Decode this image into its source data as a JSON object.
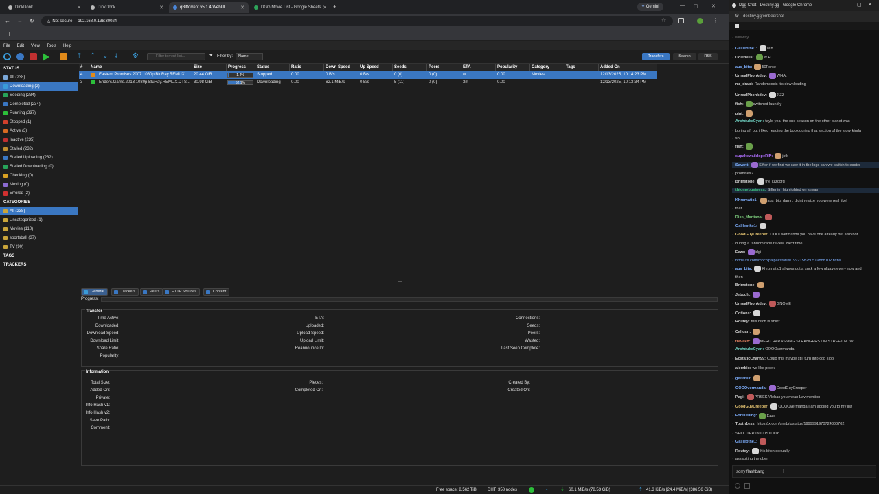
{
  "browser": {
    "tabs": [
      {
        "label": "DinkDonk"
      },
      {
        "label": "DinkDonk"
      },
      {
        "label": "qBittorrent v5.1.4 WebUI"
      },
      {
        "label": "DGG Movie List - Google Sheets"
      }
    ],
    "gemini_label": "Gemini",
    "not_secure": "Not secure",
    "url": "192.168.0.138:30024"
  },
  "qbt": {
    "menu": [
      "File",
      "Edit",
      "View",
      "Tools",
      "Help"
    ],
    "search_placeholder": "Filter torrent list...",
    "filter_by_label": "Filter by:",
    "filter_by_value": "Name",
    "right_buttons": {
      "transfers": "Transfers",
      "search": "Search",
      "rss": "RSS"
    },
    "sidebar": {
      "status_header": "STATUS",
      "status": [
        {
          "label": "All (238)",
          "color": "#7aa7d8"
        },
        {
          "label": "Downloading (2)",
          "color": "#3a9bd8",
          "selected": true
        },
        {
          "label": "Seeding (234)",
          "color": "#27a35a"
        },
        {
          "label": "Completed (234)",
          "color": "#3a77c2"
        },
        {
          "label": "Running (237)",
          "color": "#2cbf3a"
        },
        {
          "label": "Stopped (1)",
          "color": "#d0402c"
        },
        {
          "label": "Active (3)",
          "color": "#d86a22"
        },
        {
          "label": "Inactive (235)",
          "color": "#c03030"
        },
        {
          "label": "Stalled (232)",
          "color": "#c09030"
        },
        {
          "label": "Stalled Uploading (232)",
          "color": "#3a77c2"
        },
        {
          "label": "Stalled Downloading (0)",
          "color": "#27a35a"
        },
        {
          "label": "Checking (0)",
          "color": "#d8a022"
        },
        {
          "label": "Moving (0)",
          "color": "#8a6ad0"
        },
        {
          "label": "Errored (2)",
          "color": "#d03030"
        }
      ],
      "categories_header": "CATEGORIES",
      "categories": [
        {
          "label": "All (238)",
          "selected": true
        },
        {
          "label": "Uncategorized (1)"
        },
        {
          "label": "Movies (110)"
        },
        {
          "label": "sportsball (37)"
        },
        {
          "label": "TV (90)"
        }
      ],
      "tags_header": "TAGS",
      "trackers_header": "TRACKERS"
    },
    "columns": [
      "#",
      "Name",
      "Size",
      "Progress",
      "Status",
      "Ratio",
      "Down Speed",
      "Up Speed",
      "Seeds",
      "Peers",
      "ETA",
      "Popularity",
      "Category",
      "Tags",
      "Added On"
    ],
    "torrents": [
      {
        "num": "4",
        "name": "Eastern.Promises.2007.1080p.BluRay.REMUX...",
        "size": "20.44 GiB",
        "progress": 0.014,
        "progress_label": "1.4%",
        "status": "Stopped",
        "ratio": "0.00",
        "down": "0 B/s",
        "up": "0 B/s",
        "seeds": "0 (0)",
        "peers": "0 (0)",
        "eta": "∞",
        "popularity": "0.00",
        "category": "Movies",
        "tags": "",
        "added": "12/13/2025, 10:14:23 PM",
        "selected": true
      },
      {
        "num": "3",
        "name": "Enders.Game.2013.1080p.BluRay.REMUX.DTS...",
        "size": "30.98 GiB",
        "progress": 0.521,
        "progress_label": "52.1%",
        "status": "Downloading",
        "ratio": "0.00",
        "down": "62.1 MiB/s",
        "up": "0 B/s",
        "seeds": "5 (11)",
        "peers": "0 (0)",
        "eta": "3m",
        "popularity": "0.00",
        "category": "",
        "tags": "",
        "added": "12/13/2025, 10:13:34 PM",
        "selected": false
      }
    ],
    "prop_tabs": [
      "General",
      "Trackers",
      "Peers",
      "HTTP Sources",
      "Content"
    ],
    "progress_label": "Progress:",
    "transfer_header": "Transfer",
    "transfer_col1": [
      "Time Active:",
      "Downloaded:",
      "Download Speed:",
      "Download Limit:",
      "Share Ratio:",
      "Popularity:"
    ],
    "transfer_col2": [
      "ETA:",
      "Uploaded:",
      "Upload Speed:",
      "Upload Limit:",
      "Reannounce In:"
    ],
    "transfer_col3": [
      "Connections:",
      "Seeds:",
      "Peers:",
      "Wasted:",
      "Last Seen Complete:"
    ],
    "info_header": "Information",
    "info_col1": [
      "Total Size:",
      "Added On:",
      "Private:",
      "Info Hash v1:",
      "Info Hash v2:",
      "Save Path:",
      "Comment:"
    ],
    "info_col2": [
      "Pieces:",
      "Completed On:"
    ],
    "info_col3": [
      "Created By:",
      "Created On:"
    ],
    "statusbar": {
      "free_space": "Free space: 8.562 TiB",
      "dht": "DHT: 358 nodes",
      "down": "60.1 MiB/s (78.53 GiB)",
      "up": "41.3 KiB/s [24.4 MiB/s] (386.56 GiB)"
    }
  },
  "chat": {
    "window_title": "Dgg Chat - Destiny.gg - Google Chrome",
    "url": "destiny.gg/embed/chat",
    "messages": [
      {
        "user": "",
        "text": "wiwway",
        "color": "#777"
      },
      {
        "user": "Galileothe1:",
        "text": "w h",
        "color": "#7fb0ff"
      },
      {
        "user": "Dolemilis:",
        "text": "W H",
        "color": "#ccc"
      },
      {
        "user": "aus_bits:",
        "text": "50Force",
        "color": "#7fb0ff"
      },
      {
        "user": "UnrealPhonkdev:",
        "text": "WHAt",
        "color": "#ccc"
      },
      {
        "user": "mr_drapi:",
        "text": "Randomcosis it's downloading",
        "color": "#ccc"
      },
      {
        "user": "UnrealPhonkdev:",
        "text": "JIZZ",
        "color": "#ccc"
      },
      {
        "user": "fish:",
        "text": "switched laundry",
        "color": "#ccc"
      },
      {
        "user": "pipi:",
        "text": "",
        "color": "#ccc"
      },
      {
        "user": "ArchdukeCyan:",
        "text": "taylo yea, the one season on the other planet was",
        "color": "#6fd0c0"
      },
      {
        "user": "",
        "text": "boring af, but i liked reading the book during that section of the story kinda",
        "color": "#ccc"
      },
      {
        "user": "",
        "text": "so",
        "color": "#ccc"
      },
      {
        "user": "fish:",
        "text": "",
        "color": "#ccc"
      },
      {
        "user": "supakewaildopeRIP:",
        "text": "jstk",
        "color": "#b070ff"
      },
      {
        "user": "Savant:",
        "text": "Siffer if we find we saw it in the logs can we switch to easter",
        "color": "#7fb0ff"
      },
      {
        "user": "",
        "text": "promises?",
        "color": "#ccc"
      },
      {
        "user": "Brimstone:",
        "text": "the jizzcord",
        "color": "#ccc"
      },
      {
        "user": "thtomybusiness:",
        "text": "Siffer im highlighted on stream",
        "color": "#3fc07f"
      },
      {
        "user": "Khromatic1:",
        "text": "aus_bits damn, didnt realize you were real likeI",
        "color": "#7fb0ff"
      },
      {
        "user": "",
        "text": "that",
        "color": "#ccc"
      },
      {
        "user": "Rick_Montana:",
        "text": "",
        "color": "#7fd07f"
      },
      {
        "user": "Galileothe1:",
        "text": "",
        "color": "#7fb0ff"
      },
      {
        "user": "GoodGuyCreeper:",
        "text": "OOOOvermanda you have one already but also not",
        "color": "#e0c070"
      },
      {
        "user": "",
        "text": "during a random rape review. Next time",
        "color": "#ccc"
      },
      {
        "user": "Eaze:",
        "text": "idgi",
        "color": "#ccc"
      },
      {
        "user": "",
        "text": "https://x.com/mochipaipai/status/1992158250519888102 nsfw",
        "color": "#7fb0ff"
      },
      {
        "user": "aus_bits:",
        "text": "Khromatic1 always gotta suck a few glizzys every now and",
        "color": "#7fb0ff"
      },
      {
        "user": "",
        "text": "then",
        "color": "#ccc"
      },
      {
        "user": "Brimstone:",
        "text": "",
        "color": "#ccc"
      },
      {
        "user": "Jebouh:",
        "text": "",
        "color": "#ccc"
      },
      {
        "user": "UnrealPhonkdev:",
        "text": "GNOME",
        "color": "#ccc"
      },
      {
        "user": "Cotions:",
        "text": "",
        "color": "#ccc"
      },
      {
        "user": "Routey:",
        "text": "this bitch is shiltz",
        "color": "#ccc"
      },
      {
        "user": "Caligari:",
        "text": "",
        "color": "#ccc"
      },
      {
        "user": "travakh:",
        "text": "MERC HARASSING STRANGERS ON STREET NOW",
        "color": "#e08060"
      },
      {
        "user": "ArchdukeCyan:",
        "text": "OOOOvermanda",
        "color": "#6fd0c0"
      },
      {
        "user": "EcstaticChart99:",
        "text": "Could this maybe still turn into cop slop",
        "color": "#ccc"
      },
      {
        "user": "alembic:",
        "text": "we like prsek",
        "color": "#ccc"
      },
      {
        "user": "geistHD:",
        "text": "",
        "color": "#7fb0ff"
      },
      {
        "user": "OOOOvermanda:",
        "text": "GoodGuyCreeper",
        "color": "#7fb0ff"
      },
      {
        "user": "Pagi:",
        "text": "PRSEK Vlebax you mean Lav mention",
        "color": "#ccc"
      },
      {
        "user": "GoodGuyCreeper:",
        "text": "OOOOvermanda I am adding you to my list",
        "color": "#e0c070"
      },
      {
        "user": "ForeTelling:",
        "text": "Eaze",
        "color": "#7fb0ff"
      },
      {
        "user": "Tooth1ess:",
        "text": "https://x.com/cnnbrk/status/1999991970724300702",
        "color": "#ccc"
      },
      {
        "user": "",
        "text": "SHOOTER IN CUSTODY",
        "color": "#ccc"
      },
      {
        "user": "Galileothe1:",
        "text": "",
        "color": "#7fb0ff"
      },
      {
        "user": "Routey:",
        "text": "this bitch sexually",
        "color": "#ccc"
      },
      {
        "user": "",
        "text": "assaulting the uber",
        "color": "#ccc"
      }
    ],
    "input_value": "sorry flashbang"
  }
}
